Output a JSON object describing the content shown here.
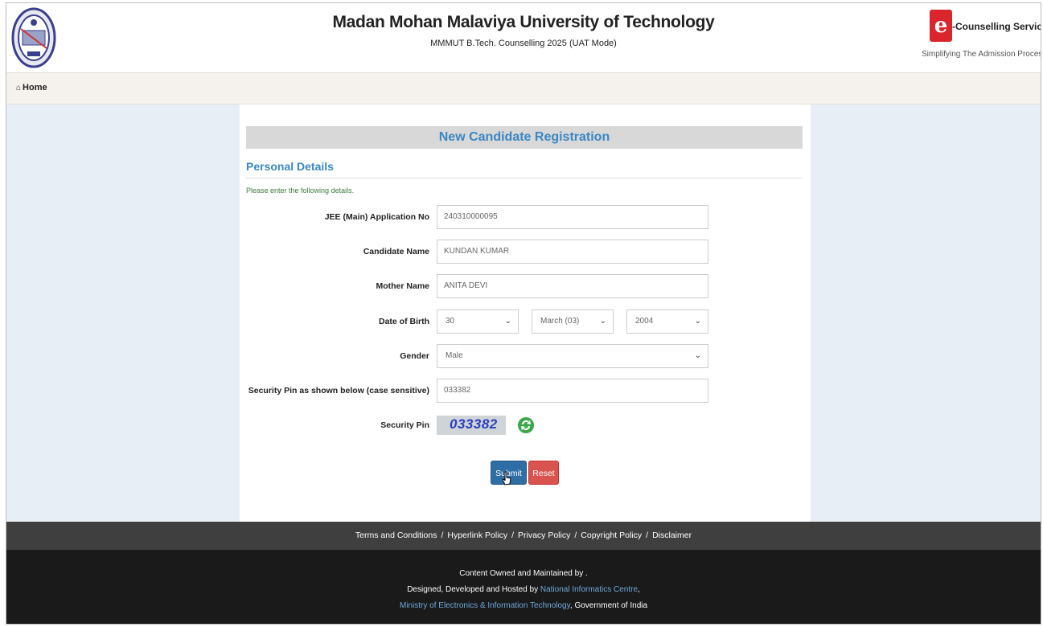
{
  "header": {
    "title": "Madan Mohan Malaviya University of Technology",
    "subtitle": "MMMUT B.Tech. Counselling 2025 (UAT Mode)",
    "brand_letter": "e",
    "brand_text": "-Counselling Services",
    "brand_tagline": "Simplifying The Admission Process"
  },
  "nav": {
    "home_label": "Home",
    "home_icon": "home-icon"
  },
  "form": {
    "heading": "New Candidate Registration",
    "section": "Personal Details",
    "hint": "Please enter the following details.",
    "jee_label": "JEE (Main) Application No",
    "jee_value": "240310000095",
    "name_label": "Candidate Name",
    "name_value": "KUNDAN KUMAR",
    "mother_label": "Mother Name",
    "mother_value": "ANITA DEVI",
    "dob_label": "Date of Birth",
    "dob_day": "30",
    "dob_month": "March (03)",
    "dob_year": "2004",
    "gender_label": "Gender",
    "gender_value": "Male",
    "pin_input_label": "Security Pin as shown below (case sensitive)",
    "pin_input_value": "033382",
    "captcha_label": "Security Pin",
    "captcha_text": "033382",
    "submit_label": "Submit",
    "reset_label": "Reset"
  },
  "footer": {
    "links": [
      "Terms and Conditions",
      "Hyperlink Policy",
      "Privacy Policy",
      "Copyright Policy",
      "Disclaimer"
    ],
    "separator": "/",
    "owned": "Content Owned and Maintained by .",
    "designed_prefix": "Designed, Developed and Hosted by ",
    "nic": "National Informatics Centre",
    "designed_suffix": ",",
    "ministry": "Ministry of Electronics & Information Technology",
    "gov": ", Government of India"
  },
  "colors": {
    "accent": "#3a87c4",
    "submit": "#2f6ea5",
    "reset": "#d9534f",
    "brand": "#d9252b"
  }
}
